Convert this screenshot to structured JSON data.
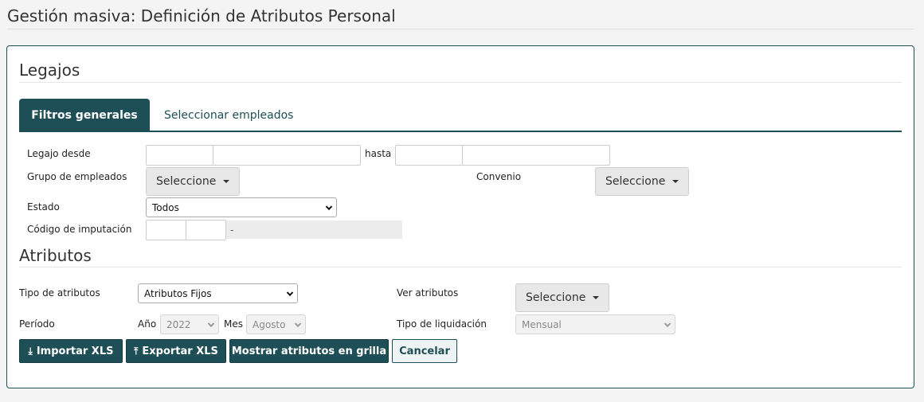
{
  "page": {
    "title": "Gestión masiva: Definición de Atributos Personal"
  },
  "legajos": {
    "title": "Legajos",
    "tabs": {
      "general": "Filtros generales",
      "select": "Seleccionar empleados"
    },
    "legajo_desde_label": "Legajo desde",
    "hasta_label": "hasta",
    "grupo_label": "Grupo de empleados",
    "grupo_value": "Seleccione",
    "convenio_label": "Convenio",
    "convenio_value": "Seleccione",
    "estado_label": "Estado",
    "estado_value": "Todos",
    "codigo_label": "Código de imputación",
    "codigo_desc": "-"
  },
  "atributos": {
    "title": "Atributos",
    "tipo_label": "Tipo de atributos",
    "tipo_value": "Atributos Fijos",
    "ver_label": "Ver atributos",
    "ver_value": "Seleccione",
    "periodo_label": "Período",
    "anio_label": "Año",
    "anio_value": "2022",
    "mes_label": "Mes",
    "mes_value": "Agosto",
    "liquidacion_label": "Tipo de liquidación",
    "liquidacion_value": "Mensual"
  },
  "actions": {
    "importar": "Importar XLS",
    "exportar": "Exportar XLS",
    "mostrar": "Mostrar atributos en grilla",
    "cancelar": "Cancelar"
  },
  "colors": {
    "primary": "#1f4f56"
  }
}
